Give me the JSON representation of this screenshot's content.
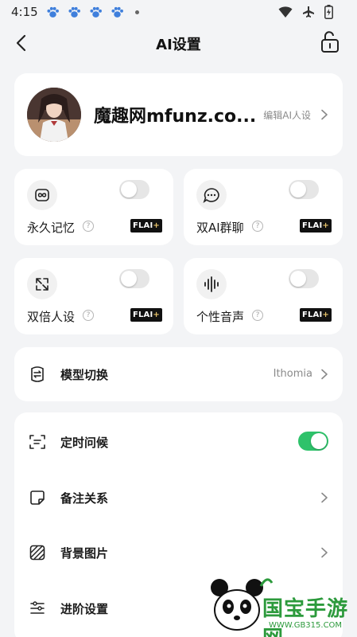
{
  "status_bar": {
    "time": "4:15"
  },
  "header": {
    "title": "AI设置"
  },
  "profile": {
    "name": "魔趣网mfunz.co...",
    "edit_label": "编辑AI人设"
  },
  "features": [
    {
      "label": "永久记忆",
      "badge": "FLAI",
      "badge_plus": "+",
      "enabled": false,
      "icon": "infinity-icon"
    },
    {
      "label": "双AI群聊",
      "badge": "FLAI",
      "badge_plus": "+",
      "enabled": false,
      "icon": "chat-bubble-icon"
    },
    {
      "label": "双倍人设",
      "badge": "FLAI",
      "badge_plus": "+",
      "enabled": false,
      "icon": "expand-icon"
    },
    {
      "label": "个性音声",
      "badge": "FLAI",
      "badge_plus": "+",
      "enabled": false,
      "icon": "voice-wave-icon"
    }
  ],
  "model_switch": {
    "label": "模型切换",
    "value": "Ithomia",
    "icon": "model-switch-icon"
  },
  "settings_list": [
    {
      "label": "定时问候",
      "icon": "scan-text-icon",
      "toggle_on": true
    },
    {
      "label": "备注关系",
      "icon": "note-icon"
    },
    {
      "label": "背景图片",
      "icon": "stripes-image-icon"
    },
    {
      "label": "进阶设置",
      "icon": "sliders-icon"
    }
  ],
  "watermark": {
    "text": "国宝手游网",
    "url": "WWW.GB315.COM"
  },
  "colors": {
    "accent_green": "#2ec26a",
    "card": "#ffffff",
    "background": "#f3f4f6"
  }
}
